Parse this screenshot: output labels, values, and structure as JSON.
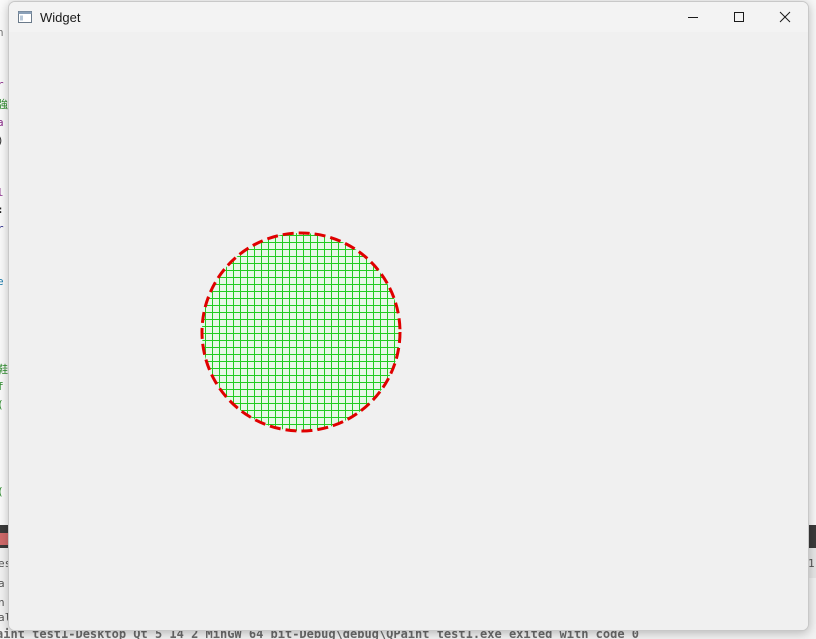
{
  "window": {
    "title": "Widget",
    "icon": "app-window-icon",
    "controls": [
      "minimize-icon",
      "maximize-icon",
      "close-icon"
    ]
  },
  "canvas": {
    "shape": "circle",
    "fill_pattern": "cross-hatch",
    "fill_color": "#22cc22",
    "fill_background": "#e8f8e8",
    "stroke_color": "#e00000",
    "stroke_style": "dashed"
  },
  "background": {
    "editor_fragments": [
      "n",
      "r",
      "強",
      "a",
      ")",
      "l",
      ":",
      "r",
      "e",
      "鞋",
      "f",
      "(",
      "("
    ],
    "console_fragments": [
      "es",
      "a",
      "n",
      "al"
    ],
    "right_fragment": "1",
    "status_text": "aint_test1-Desktop_Qt_5_14_2_MinGW_64_bit-Debug\\debug\\QPaint_test1.exe exited with code 0"
  }
}
